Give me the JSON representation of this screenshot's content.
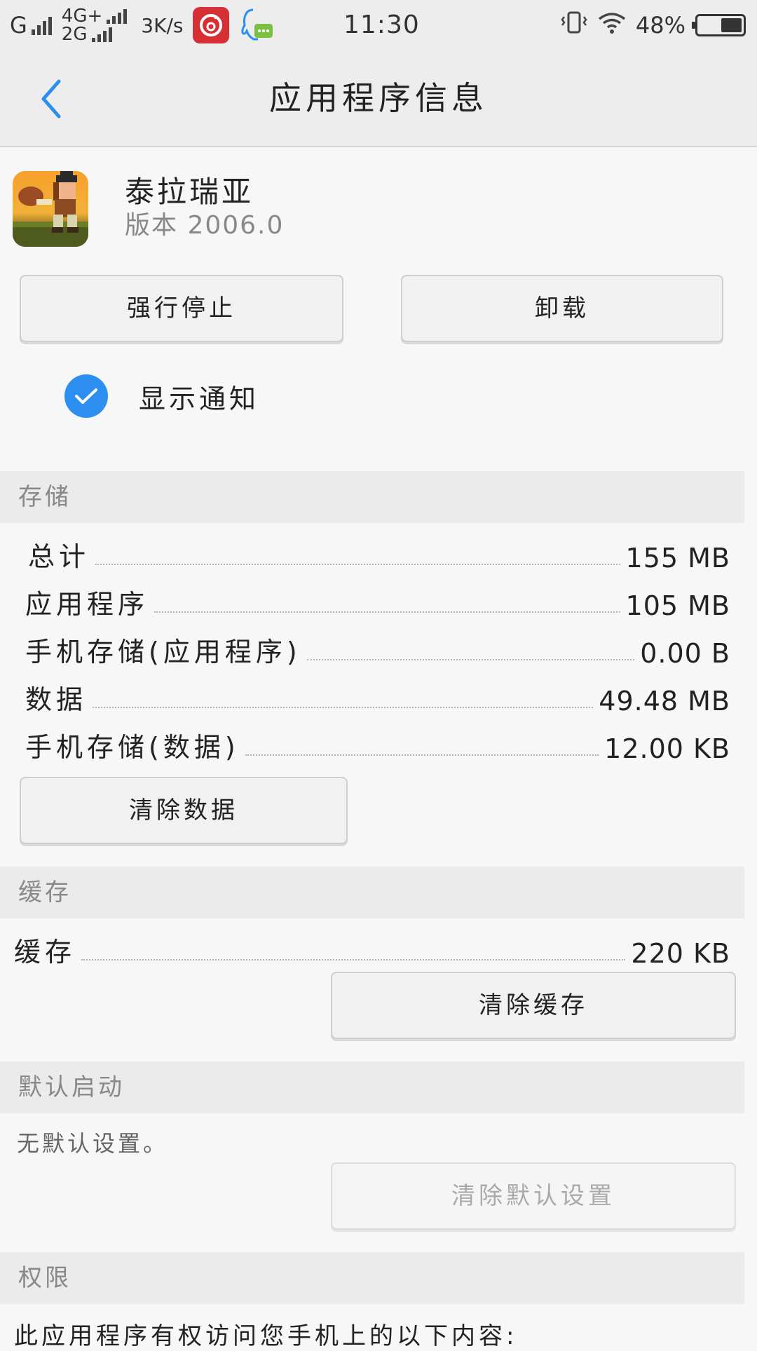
{
  "status_bar": {
    "signal1_label": "G",
    "signal2_top": "4G+",
    "signal2_bottom": "2G",
    "speed": "3K/s",
    "time": "11:30",
    "battery_percent": "48%",
    "battery_level": 0.48
  },
  "header": {
    "title": "应用程序信息"
  },
  "app": {
    "name": "泰拉瑞亚",
    "version": "版本 2006.0"
  },
  "actions": {
    "force_stop": "强行停止",
    "uninstall": "卸载"
  },
  "notification": {
    "label": "显示通知",
    "checked": true
  },
  "storage": {
    "section_title": "存储",
    "rows": [
      {
        "label": "总计",
        "value": "155 MB"
      },
      {
        "label": "应用程序",
        "value": "105 MB"
      },
      {
        "label": "手机存储(应用程序)",
        "value": "0.00 B"
      },
      {
        "label": "数据",
        "value": "49.48 MB"
      },
      {
        "label": "手机存储(数据)",
        "value": "12.00 KB"
      }
    ],
    "clear_data": "清除数据"
  },
  "cache": {
    "section_title": "缓存",
    "label": "缓存",
    "value": "220 KB",
    "clear_cache": "清除缓存"
  },
  "default_launch": {
    "section_title": "默认启动",
    "text": "无默认设置。",
    "clear_defaults": "清除默认设置"
  },
  "permissions": {
    "section_title": "权限",
    "text": "此应用程序有权访问您手机上的以下内容:"
  },
  "colors": {
    "accent": "#2c8ff0",
    "status_bar_bg": "#ededed",
    "section_bg": "#ebebeb"
  }
}
